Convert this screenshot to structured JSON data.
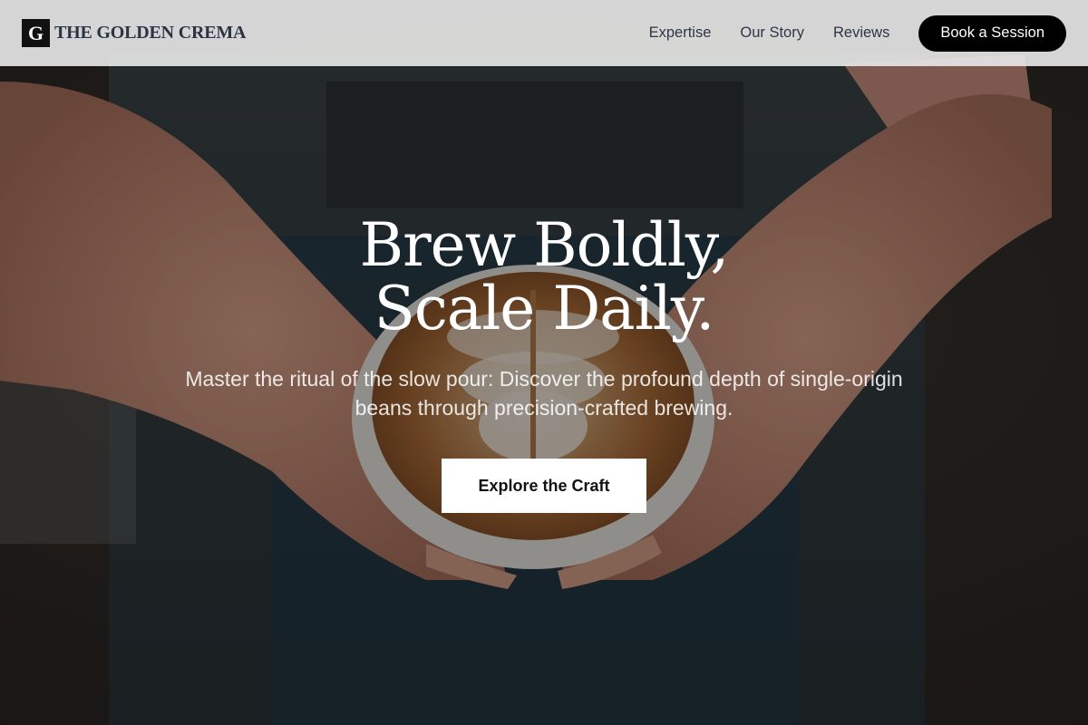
{
  "brand": {
    "mark": "G",
    "name": "THE GOLDEN CREMA"
  },
  "nav": {
    "links": [
      "Expertise",
      "Our Story",
      "Reviews"
    ],
    "cta_label": "Book a Session"
  },
  "hero": {
    "headline_line1": "Brew Boldly,",
    "headline_line2": "Scale Daily.",
    "subheadline": "Master the ritual of the slow pour: Discover the profound depth of single-origin beans through precision-crafted brewing.",
    "cta_label": "Explore the Craft"
  },
  "colors": {
    "nav_background": "#e4e4e4",
    "primary_button": "#000000",
    "secondary_button": "#ffffff",
    "heading_text": "#ffffff"
  }
}
